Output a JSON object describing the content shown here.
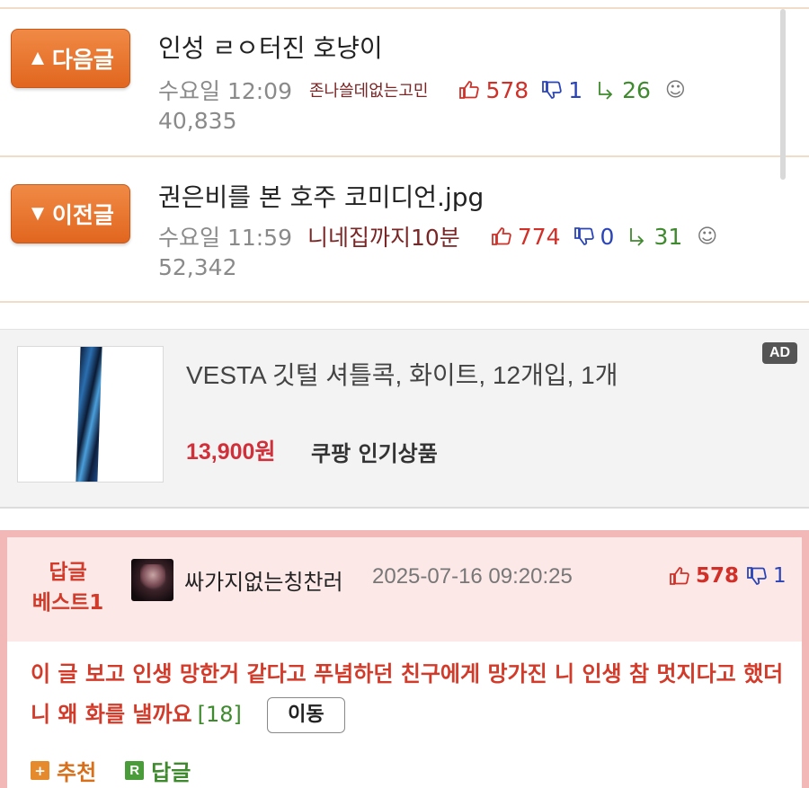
{
  "nav": {
    "next": {
      "button_label": "다음글",
      "arrow": "▲",
      "title": "인성 ㄹㅇ터진 호냥이",
      "time": "수요일 12:09",
      "author": "존나쓸데없는고민",
      "likes": "578",
      "dislikes": "1",
      "replies": "26",
      "views": "40,835"
    },
    "prev": {
      "button_label": "이전글",
      "arrow": "▼",
      "title": "권은비를 본 호주 코미디언.jpg",
      "time": "수요일 11:59",
      "author": "니네집까지10분",
      "likes": "774",
      "dislikes": "0",
      "replies": "31",
      "views": "52,342"
    }
  },
  "ad": {
    "product": "VESTA 깃털 셔틀콕, 화이트, 12개입, 1개",
    "price": "13,900원",
    "store": "쿠팡 인기상품",
    "badge": "AD"
  },
  "best_reply": {
    "label_line1": "답글",
    "label_line2": "베스트1",
    "author": "싸가지없는칭찬러",
    "datetime": "2025-07-16 09:20:25",
    "likes": "578",
    "dislikes": "1",
    "text": "이 글 보고 인생 망한거 같다고 푸념하던 친구에게 망가진 니 인생 참 멋지다고 했더니 왜 화를 낼까요",
    "comment_count": "[18]",
    "move_label": "이동",
    "recommend_label": "추천",
    "reply_label": "답글"
  },
  "colors": {
    "nav_button": "#e8742e",
    "like": "#d03028",
    "dislike": "#2a44b8",
    "reply": "#3f8a2e",
    "best_text": "#d23a2a",
    "best_bg": "#fde8e8",
    "best_border": "#f2b8b8"
  }
}
